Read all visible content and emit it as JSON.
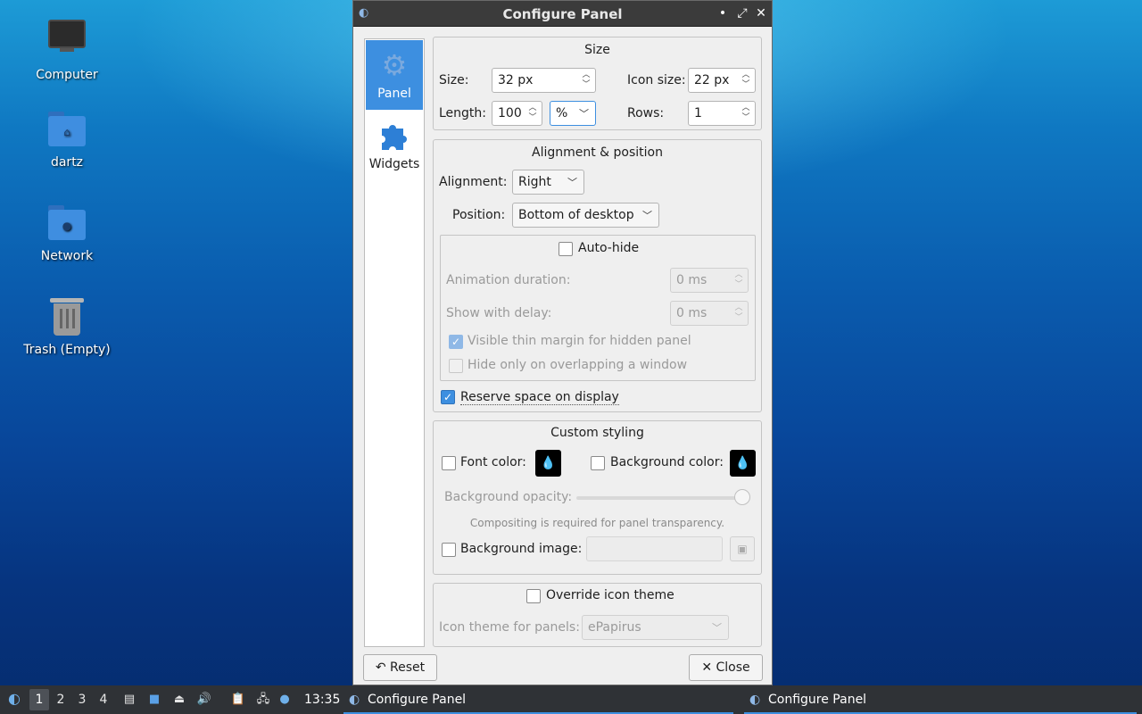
{
  "desktop": {
    "icons": [
      {
        "label": "Computer",
        "icon": "computer-icon"
      },
      {
        "label": "dartz",
        "icon": "home-folder-icon"
      },
      {
        "label": "Network",
        "icon": "network-folder-icon"
      },
      {
        "label": "Trash (Empty)",
        "icon": "trash-icon"
      }
    ]
  },
  "window": {
    "title": "Configure Panel",
    "controls": {
      "minimize": "•",
      "maximize": "⤢",
      "close": "✕"
    }
  },
  "sidebar": {
    "items": [
      {
        "label": "Panel",
        "icon": "gear-icon",
        "selected": true
      },
      {
        "label": "Widgets",
        "icon": "puzzle-icon",
        "selected": false
      }
    ]
  },
  "size_group": {
    "title": "Size",
    "size_label": "Size:",
    "size_value": "32 px",
    "icon_size_label": "Icon size:",
    "icon_size_value": "22 px",
    "length_label": "Length:",
    "length_value": "100",
    "length_unit": "%",
    "rows_label": "Rows:",
    "rows_value": "1"
  },
  "alignment_group": {
    "title": "Alignment & position",
    "alignment_label": "Alignment:",
    "alignment_value": "Right",
    "position_label": "Position:",
    "position_value": "Bottom of desktop",
    "autohide_label": "Auto-hide",
    "autohide_checked": false,
    "animation_label": "Animation duration:",
    "animation_value": "0 ms",
    "delay_label": "Show with delay:",
    "delay_value": "0 ms",
    "thin_margin_label": "Visible thin margin for hidden panel",
    "thin_margin_checked": true,
    "overlap_label": "Hide only on overlapping a window",
    "overlap_checked": false,
    "reserve_label": "Reserve space on display",
    "reserve_checked": true
  },
  "styling_group": {
    "title": "Custom styling",
    "font_color_label": "Font color:",
    "bg_color_label": "Background color:",
    "opacity_label": "Background opacity:",
    "opacity_level": 1.0,
    "compositing_note": "Compositing is required for panel transparency.",
    "bg_image_label": "Background image:",
    "bg_image_value": ""
  },
  "icon_theme_group": {
    "override_label": "Override icon theme",
    "override_checked": false,
    "theme_label": "Icon theme for panels:",
    "theme_value": "ePapirus"
  },
  "buttons": {
    "reset": "Reset",
    "close": "Close"
  },
  "taskbar": {
    "desktops": [
      "1",
      "2",
      "3",
      "4"
    ],
    "active_desktop": "1",
    "clock": "13:35",
    "tasks": [
      "Configure Panel",
      "Configure Panel"
    ]
  },
  "colors": {
    "accent": "#3d8fe0",
    "titlebar": "#3b3b3b",
    "taskbar": "#2f3236"
  }
}
